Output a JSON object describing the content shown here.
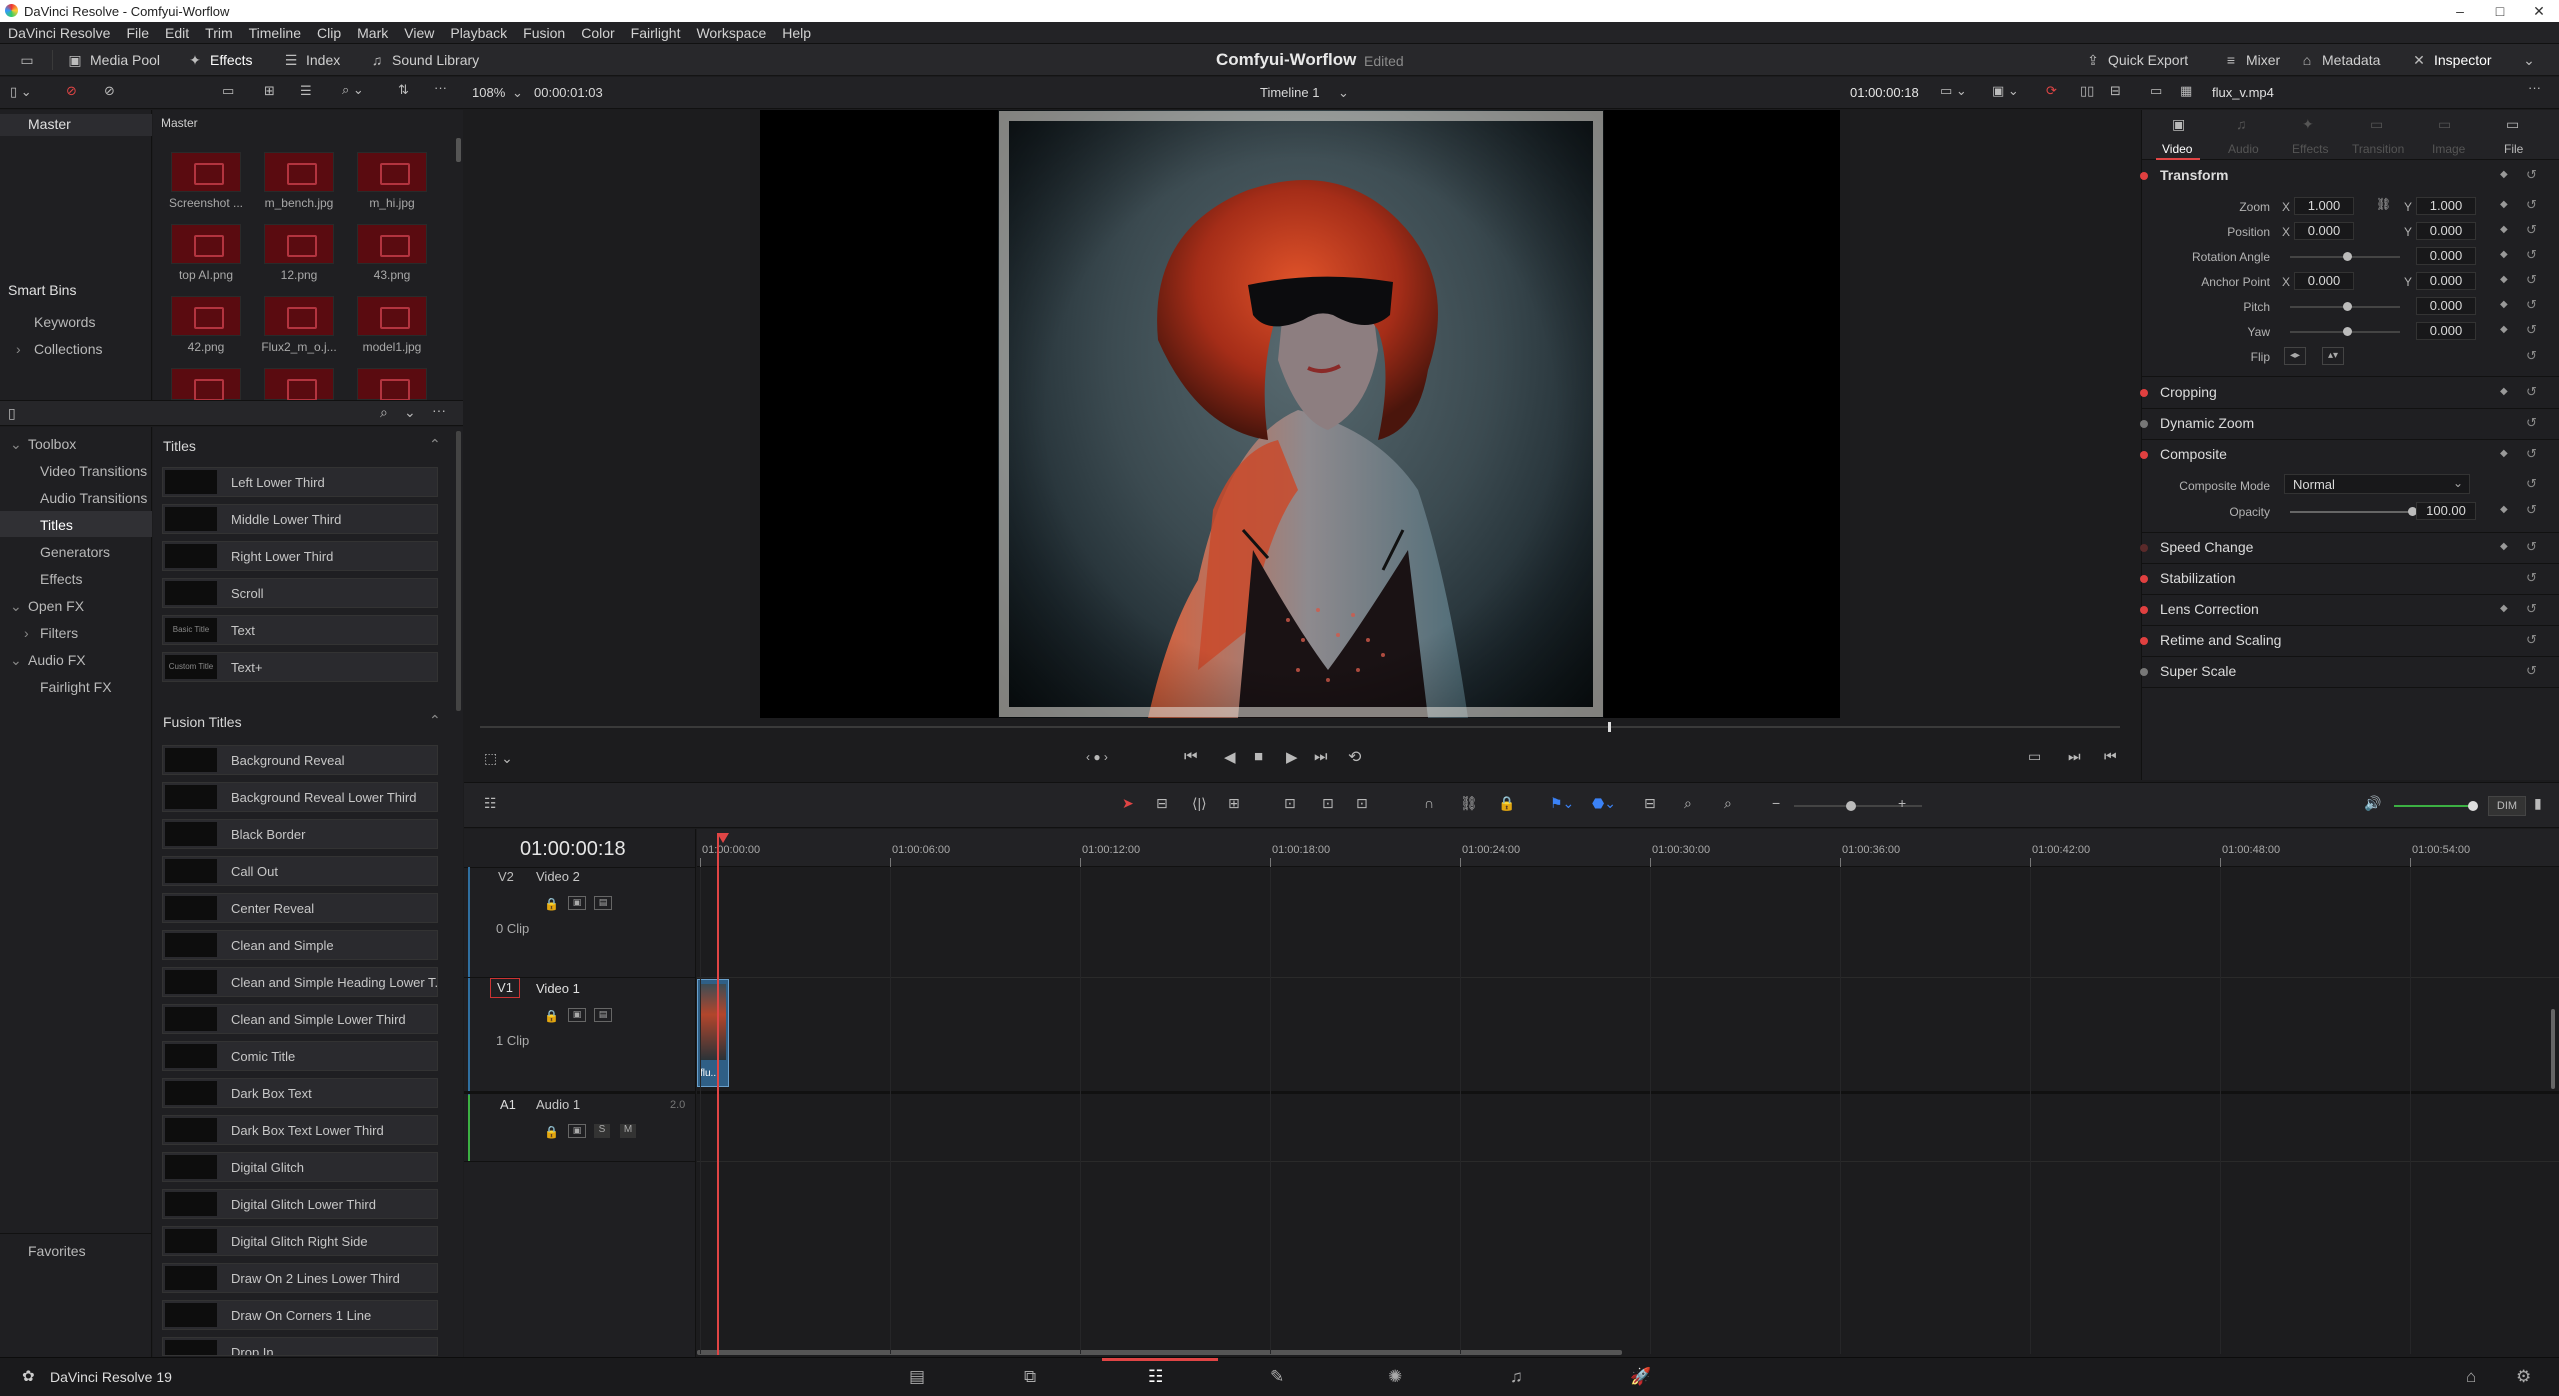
{
  "window": {
    "title": "DaVinci Resolve - Comfyui-Worflow",
    "controls": [
      "–",
      "□",
      "✕"
    ]
  },
  "menu": [
    "DaVinci Resolve",
    "File",
    "Edit",
    "Trim",
    "Timeline",
    "Clip",
    "Mark",
    "View",
    "Playback",
    "Fusion",
    "Color",
    "Fairlight",
    "Workspace",
    "Help"
  ],
  "toolbar": {
    "media_pool": "Media Pool",
    "effects": "Effects",
    "index": "Index",
    "sound_library": "Sound Library",
    "project": "Comfyui-Worflow",
    "status": "Edited",
    "quick_export": "Quick Export",
    "mixer": "Mixer",
    "metadata": "Metadata",
    "inspector": "Inspector"
  },
  "viewer_bar": {
    "zoom": "108%",
    "source_tc": "00:00:01:03",
    "timeline_name": "Timeline 1",
    "record_tc": "01:00:00:18",
    "clip_name": "flux_v.mp4"
  },
  "media_pool": {
    "master_label": "Master",
    "master_header": "Master",
    "clips": [
      "Screenshot ...",
      "m_bench.jpg",
      "m_hi.jpg",
      "top AI.png",
      "12.png",
      "43.png",
      "42.png",
      "Flux2_m_o.j...",
      "model1.jpg"
    ],
    "smart_bins": "Smart Bins",
    "keywords": "Keywords",
    "collections": "Collections"
  },
  "effects_nav": {
    "toolbox": "Toolbox",
    "video_transitions": "Video Transitions",
    "audio_transitions": "Audio Transitions",
    "titles": "Titles",
    "generators": "Generators",
    "effects": "Effects",
    "open_fx": "Open FX",
    "filters": "Filters",
    "audio_fx": "Audio FX",
    "fairlight_fx": "Fairlight FX",
    "favorites": "Favorites"
  },
  "titles_header": "Titles",
  "titles": [
    {
      "name": "Left Lower Third",
      "thumb": ""
    },
    {
      "name": "Middle Lower Third",
      "thumb": ""
    },
    {
      "name": "Right Lower Third",
      "thumb": ""
    },
    {
      "name": "Scroll",
      "thumb": ""
    },
    {
      "name": "Text",
      "thumb": "Basic Title"
    },
    {
      "name": "Text+",
      "thumb": "Custom Title"
    }
  ],
  "fusion_header": "Fusion Titles",
  "fusion_titles": [
    "Background Reveal",
    "Background Reveal Lower Third",
    "Black Border",
    "Call Out",
    "Center Reveal",
    "Clean and Simple",
    "Clean and Simple Heading Lower T...",
    "Clean and Simple Lower Third",
    "Comic Title",
    "Dark Box Text",
    "Dark Box Text Lower Third",
    "Digital Glitch",
    "Digital Glitch Lower Third",
    "Digital Glitch Right Side",
    "Draw On 2 Lines Lower Third",
    "Draw On Corners 1 Line",
    "Drop In"
  ],
  "inspector": {
    "tabs": [
      "Video",
      "Audio",
      "Effects",
      "Transition",
      "Image",
      "File"
    ],
    "transform": "Transform",
    "zoom_label": "Zoom",
    "zoom_x": "1.000",
    "zoom_y": "1.000",
    "position_label": "Position",
    "pos_x": "0.000",
    "pos_y": "0.000",
    "rotation_label": "Rotation Angle",
    "rotation": "0.000",
    "anchor_label": "Anchor Point",
    "anchor_x": "0.000",
    "anchor_y": "0.000",
    "pitch_label": "Pitch",
    "pitch": "0.000",
    "yaw_label": "Yaw",
    "yaw": "0.000",
    "flip_label": "Flip",
    "x": "X",
    "y": "Y",
    "cropping": "Cropping",
    "dynamic_zoom": "Dynamic Zoom",
    "composite": "Composite",
    "composite_mode_label": "Composite Mode",
    "composite_mode": "Normal",
    "opacity_label": "Opacity",
    "opacity": "100.00",
    "speed_change": "Speed Change",
    "stabilization": "Stabilization",
    "lens_correction": "Lens Correction",
    "retime": "Retime and Scaling",
    "super_scale": "Super Scale"
  },
  "timeline": {
    "timecode": "01:00:00:18",
    "ruler": [
      "01:00:00:00",
      "01:00:06:00",
      "01:00:12:00",
      "01:00:18:00",
      "01:00:24:00",
      "01:00:30:00",
      "01:00:36:00",
      "01:00:42:00",
      "01:00:48:00",
      "01:00:54:00"
    ],
    "v2": {
      "id": "V2",
      "name": "Video 2",
      "clips": "0 Clip"
    },
    "v1": {
      "id": "V1",
      "name": "Video 1",
      "clips": "1 Clip"
    },
    "a1": {
      "id": "A1",
      "name": "Audio 1",
      "level": "2.0"
    },
    "clip_label": "flu...",
    "dim": "DIM",
    "solo": "S",
    "mute": "M"
  },
  "footer": {
    "app": "DaVinci Resolve 19"
  }
}
